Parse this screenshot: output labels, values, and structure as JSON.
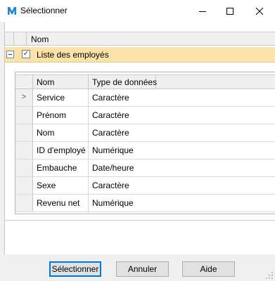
{
  "window": {
    "title": "Sélectionner",
    "accent": "#1e88d8",
    "controls": {
      "minimize_icon": "minimize-icon",
      "maximize_icon": "maximize-icon",
      "close_icon": "close-icon"
    }
  },
  "outer_grid": {
    "header": "Nom",
    "group": {
      "label": "Liste des employés",
      "checked": true,
      "expanded": true,
      "highlight_color": "#fbe2a8"
    }
  },
  "fields_grid": {
    "columns": [
      "Nom",
      "Type de données"
    ],
    "rows": [
      {
        "nom": "Service",
        "type": "Caractère",
        "selector": ">"
      },
      {
        "nom": "Prénom",
        "type": "Caractère",
        "selector": ""
      },
      {
        "nom": "Nom",
        "type": "Caractère",
        "selector": ""
      },
      {
        "nom": "ID d'employé",
        "type": "Numérique",
        "selector": ""
      },
      {
        "nom": "Embauche",
        "type": "Date/heure",
        "selector": ""
      },
      {
        "nom": "Sexe",
        "type": "Caractère",
        "selector": ""
      },
      {
        "nom": "Revenu net",
        "type": "Numérique",
        "selector": ""
      }
    ]
  },
  "buttons": {
    "select": "Sélectionner",
    "cancel": "Annuler",
    "help": "Aide"
  }
}
